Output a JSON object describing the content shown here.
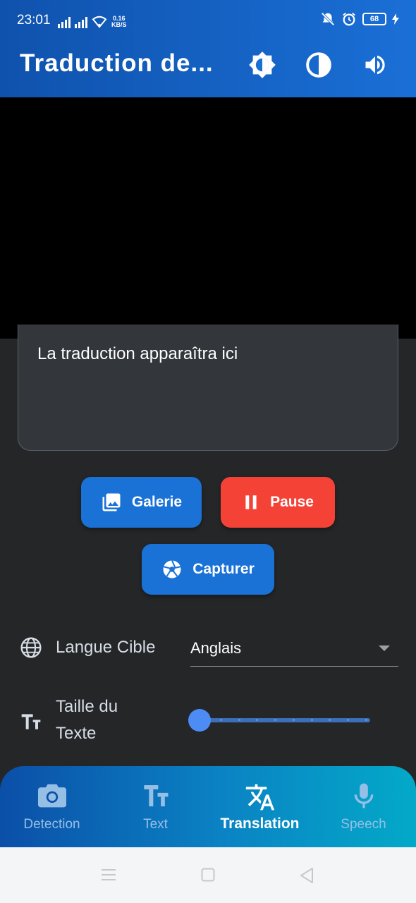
{
  "status_bar": {
    "time": "23:01",
    "net_speed_value": "0.16",
    "net_speed_unit": "KB/S",
    "battery": "68"
  },
  "app_bar": {
    "title": "Traduction de...",
    "actions": [
      {
        "icon": "brightness-icon"
      },
      {
        "icon": "contrast-icon"
      },
      {
        "icon": "volume-icon"
      }
    ]
  },
  "translation": {
    "placeholder": "La traduction apparaîtra ici"
  },
  "buttons": {
    "gallery": "Galerie",
    "pause": "Pause",
    "capture": "Capturer"
  },
  "settings": {
    "target_language_label": "Langue Cible",
    "target_language_value": "Anglais",
    "text_size_label_line1": "Taille du",
    "text_size_label_line2": "Texte",
    "text_size_level": 0
  },
  "bottom_nav": {
    "items": [
      {
        "label": "Detection",
        "icon": "camera-icon",
        "active": false
      },
      {
        "label": "Text",
        "icon": "text-size-icon",
        "active": false
      },
      {
        "label": "Translation",
        "icon": "translate-icon",
        "active": true
      },
      {
        "label": "Speech",
        "icon": "microphone-icon",
        "active": false
      }
    ]
  },
  "colors": {
    "primary": "#1a72d6",
    "danger": "#f44336",
    "background": "#252627"
  }
}
